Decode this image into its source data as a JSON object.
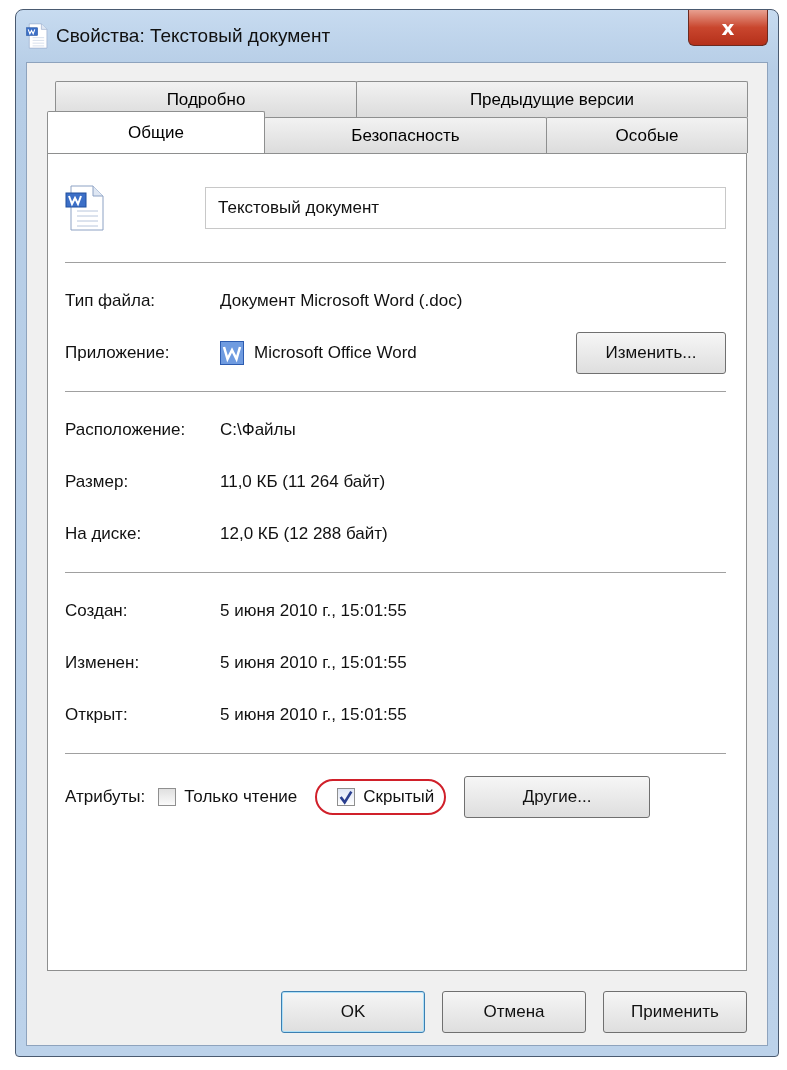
{
  "window": {
    "title": "Свойства: Текстовый документ",
    "close": "x"
  },
  "tab_rows": [
    [
      {
        "label": "Подробно",
        "selected": false
      },
      {
        "label": "Предыдущие версии",
        "selected": false
      }
    ],
    [
      {
        "label": "Общие",
        "selected": true
      },
      {
        "label": "Безопасность",
        "selected": false
      },
      {
        "label": "Особые",
        "selected": false
      }
    ]
  ],
  "file_name": "Текстовый документ",
  "sections": [
    [
      {
        "label": "Тип файла:",
        "value": "Документ Microsoft Word (.doc)"
      },
      {
        "label": "Приложение:",
        "value": "Microsoft Office Word",
        "kind": "app",
        "button": "Изменить..."
      }
    ],
    [
      {
        "label": "Расположение:",
        "value": "C:\\Файлы"
      },
      {
        "label": "Размер:",
        "value": "11,0 КБ (11 264 байт)"
      },
      {
        "label": "На диске:",
        "value": "12,0 КБ (12 288 байт)"
      }
    ],
    [
      {
        "label": "Создан:",
        "value": "5 июня 2010 г., 15:01:55"
      },
      {
        "label": "Изменен:",
        "value": "5 июня 2010 г., 15:01:55"
      },
      {
        "label": "Открыт:",
        "value": "5 июня 2010 г., 15:01:55"
      }
    ]
  ],
  "attributes": {
    "label": "Атрибуты:",
    "items": [
      {
        "label": "Только чтение",
        "checked": false,
        "highlighted": false
      },
      {
        "label": "Скрытый",
        "checked": true,
        "highlighted": true
      }
    ],
    "button": "Другие..."
  },
  "buttons": [
    {
      "label": "OK",
      "default": true
    },
    {
      "label": "Отмена",
      "default": false
    },
    {
      "label": "Применить",
      "default": false
    }
  ]
}
